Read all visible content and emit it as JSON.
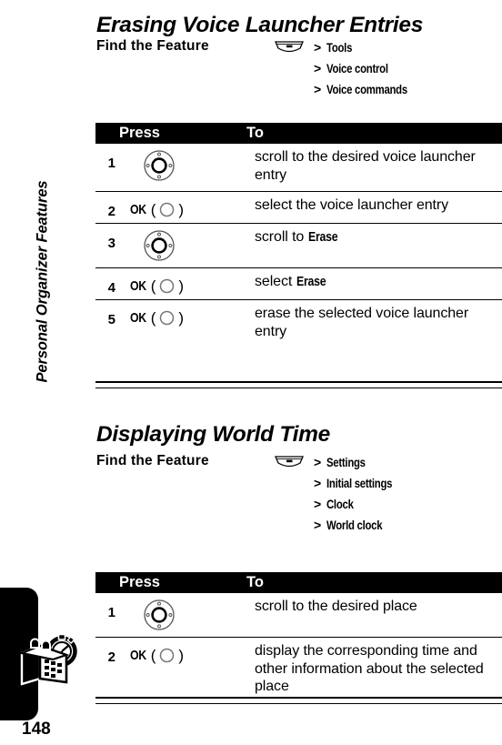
{
  "page": {
    "number": "148",
    "chapter_label": "Personal Organizer Features",
    "tab_icon": "organizer-stopwatch-icon"
  },
  "sections": [
    {
      "id": "erasing-voice-launcher-entries",
      "title": "Erasing Voice Launcher Entries",
      "find_the_feature": {
        "label": "Find the Feature",
        "menu_icon": "menu-key-icon",
        "separator": ">",
        "path": [
          "Tools",
          "Voice control",
          "Voice commands"
        ]
      },
      "table": {
        "headers": {
          "num": "",
          "press": "Press",
          "to": "To"
        },
        "rows": [
          {
            "num": "1",
            "press_type": "nav-key",
            "press_icon": "navigation-key-icon",
            "press_label": "",
            "to_text": "scroll to the desired voice launcher entry",
            "to_bold": ""
          },
          {
            "num": "2",
            "press_type": "soft-key",
            "press_icon": "center-select-key-icon",
            "press_label": "OK",
            "to_text": "select the voice launcher entry",
            "to_bold": ""
          },
          {
            "num": "3",
            "press_type": "nav-key",
            "press_icon": "navigation-key-icon",
            "press_label": "",
            "to_text": "scroll to ",
            "to_bold": "Erase"
          },
          {
            "num": "4",
            "press_type": "soft-key",
            "press_icon": "center-select-key-icon",
            "press_label": "OK",
            "to_text": "select ",
            "to_bold": "Erase"
          },
          {
            "num": "5",
            "press_type": "soft-key",
            "press_icon": "center-select-key-icon",
            "press_label": "OK",
            "to_text": "erase the selected voice launcher entry",
            "to_bold": ""
          }
        ]
      }
    },
    {
      "id": "displaying-world-time",
      "title": "Displaying World Time",
      "find_the_feature": {
        "label": "Find the Feature",
        "menu_icon": "menu-key-icon",
        "separator": ">",
        "path": [
          "Settings",
          "Initial settings",
          "Clock",
          "World clock"
        ]
      },
      "table": {
        "headers": {
          "num": "",
          "press": "Press",
          "to": "To"
        },
        "rows": [
          {
            "num": "1",
            "press_type": "nav-key",
            "press_icon": "navigation-key-icon",
            "press_label": "",
            "to_text": "scroll to the desired place",
            "to_bold": ""
          },
          {
            "num": "2",
            "press_type": "soft-key",
            "press_icon": "center-select-key-icon",
            "press_label": "OK",
            "to_text": "display the corresponding time and other information about the selected place",
            "to_bold": ""
          }
        ]
      }
    }
  ],
  "colors": {
    "text": "#000000",
    "background": "#ffffff",
    "header_bar": "#000000",
    "header_text": "#ffffff"
  }
}
